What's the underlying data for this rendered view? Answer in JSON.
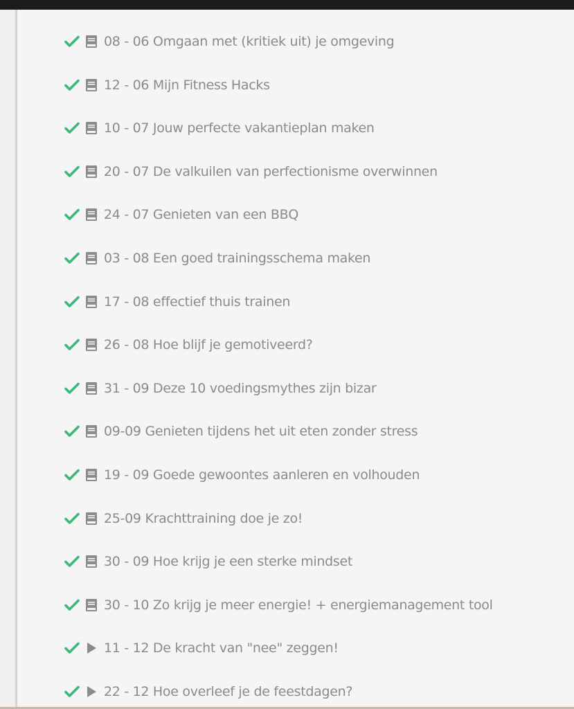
{
  "lessons": [
    {
      "title": "08 - 06 Omgaan met (kritiek uit) je omgeving",
      "completed": true,
      "type": "text",
      "icon": "book-icon"
    },
    {
      "title": "12 - 06 Mijn Fitness Hacks",
      "completed": true,
      "type": "text",
      "icon": "book-icon"
    },
    {
      "title": "10 - 07 Jouw perfecte vakantieplan maken",
      "completed": true,
      "type": "text",
      "icon": "book-icon"
    },
    {
      "title": "20 - 07 De valkuilen van perfectionisme overwinnen",
      "completed": true,
      "type": "text",
      "icon": "book-icon"
    },
    {
      "title": "24 - 07 Genieten van een BBQ",
      "completed": true,
      "type": "text",
      "icon": "book-icon"
    },
    {
      "title": "03 - 08 Een goed trainingsschema maken",
      "completed": true,
      "type": "text",
      "icon": "book-icon"
    },
    {
      "title": "17 - 08 effectief thuis trainen",
      "completed": true,
      "type": "text",
      "icon": "book-icon"
    },
    {
      "title": "26 - 08 Hoe blijf je gemotiveerd?",
      "completed": true,
      "type": "text",
      "icon": "book-icon"
    },
    {
      "title": "31 - 09 Deze 10 voedingsmythes zijn bizar",
      "completed": true,
      "type": "text",
      "icon": "book-icon"
    },
    {
      "title": "09-09 Genieten tijdens het uit eten zonder stress",
      "completed": true,
      "type": "text",
      "icon": "book-icon"
    },
    {
      "title": "19 - 09 Goede gewoontes aanleren en volhouden",
      "completed": true,
      "type": "text",
      "icon": "book-icon"
    },
    {
      "title": "25-09 Krachttraining doe je zo!",
      "completed": true,
      "type": "text",
      "icon": "book-icon"
    },
    {
      "title": "30 - 09 Hoe krijg je een sterke mindset",
      "completed": true,
      "type": "text",
      "icon": "book-icon"
    },
    {
      "title": "30 - 10 Zo krijg je meer energie! + energiemanagement tool",
      "completed": true,
      "type": "text",
      "icon": "book-icon"
    },
    {
      "title": "11 - 12 De kracht van \"nee\" zeggen!",
      "completed": true,
      "type": "video",
      "icon": "play-icon"
    },
    {
      "title": "22 - 12 Hoe overleef je de feestdagen?",
      "completed": true,
      "type": "video",
      "icon": "play-icon"
    }
  ],
  "colors": {
    "check": "#3cb878",
    "icon": "#8c8c8c",
    "text": "#8a8a8a",
    "background": "#f5f5f5",
    "top_bar": "#1c1c1c"
  }
}
